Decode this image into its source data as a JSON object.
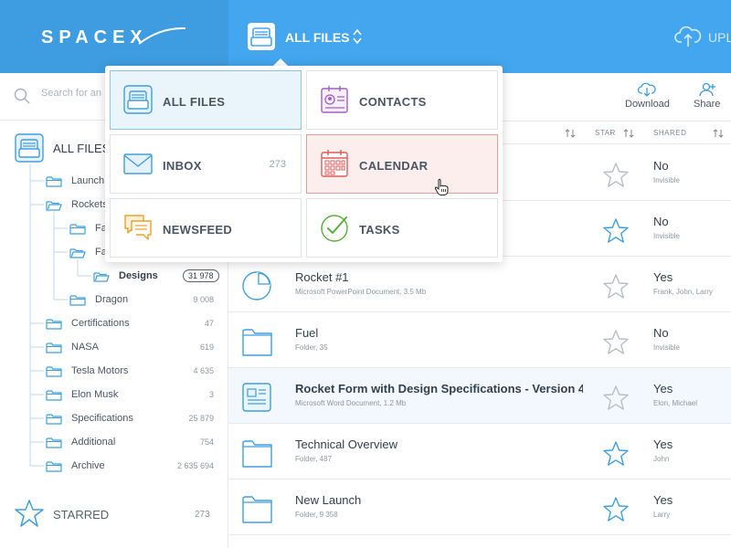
{
  "brand": {
    "logo_text": "SPACEX"
  },
  "topbar": {
    "title": "ALL FILES",
    "upload_label": "UPL"
  },
  "search": {
    "placeholder": "Search for an"
  },
  "sidebar": {
    "all_files_label": "ALL FILES",
    "tree": [
      {
        "label": "Launch",
        "count": ""
      },
      {
        "label": "Rockets",
        "count": ""
      },
      {
        "label": "Fa",
        "count": ""
      },
      {
        "label": "Fa",
        "count": ""
      },
      {
        "label": "Designs",
        "count": "31 978"
      },
      {
        "label": "Dragon",
        "count": "9 008"
      },
      {
        "label": "Certifications",
        "count": "47"
      },
      {
        "label": "NASA",
        "count": "619"
      },
      {
        "label": "Tesla Motors",
        "count": "4 635"
      },
      {
        "label": "Elon Musk",
        "count": "3"
      },
      {
        "label": "Specifications",
        "count": "25 879"
      },
      {
        "label": "Additional",
        "count": "754"
      },
      {
        "label": "Archive",
        "count": "2 635 694"
      }
    ],
    "starred_label": "STARRED",
    "starred_count": "273"
  },
  "actions": {
    "download_label": "Download",
    "share_label": "Share"
  },
  "columns": {
    "star": "STAR",
    "shared": "SHARED"
  },
  "files": [
    {
      "name": "",
      "sub": "",
      "shared": "No",
      "people": "Invisible",
      "icon": "folder-icon",
      "starred": false
    },
    {
      "name": "",
      "sub": "",
      "shared": "No",
      "people": "Invisible",
      "icon": "folder-icon",
      "starred": true
    },
    {
      "name": "Rocket #1",
      "sub": "Microsoft PowerPoint Document,  3.5 Mb",
      "shared": "Yes",
      "people": "Frank, John, Larry",
      "icon": "pie-chart-icon",
      "starred": false
    },
    {
      "name": "Fuel",
      "sub": "Folder,  35",
      "shared": "No",
      "people": "Invisible",
      "icon": "folder-icon",
      "starred": false
    },
    {
      "name": "Rocket Form with Design Specifications - Version 4",
      "sub": "Microsoft Word Document,  1.2 Mb",
      "shared": "Yes",
      "people": "Elon, Michael",
      "icon": "document-icon",
      "starred": false
    },
    {
      "name": "Technical Overview",
      "sub": "Folder,  487",
      "shared": "Yes",
      "people": "John",
      "icon": "folder-icon",
      "starred": true
    },
    {
      "name": "New Launch",
      "sub": "Folder,  9 358",
      "shared": "Yes",
      "people": "Larry",
      "icon": "folder-icon",
      "starred": true
    }
  ],
  "dropdown": {
    "tiles": [
      {
        "label": "ALL FILES",
        "count": "",
        "icon": "files-icon",
        "state": "active"
      },
      {
        "label": "CONTACTS",
        "count": "",
        "icon": "contacts-icon",
        "state": ""
      },
      {
        "label": "INBOX",
        "count": "273",
        "icon": "envelope-icon",
        "state": ""
      },
      {
        "label": "CALENDAR",
        "count": "",
        "icon": "calendar-icon",
        "state": "hover"
      },
      {
        "label": "NEWSFEED",
        "count": "",
        "icon": "chat-bubbles-icon",
        "state": ""
      },
      {
        "label": "TASKS",
        "count": "",
        "icon": "checkmark-icon",
        "state": ""
      }
    ]
  },
  "colors": {
    "brand_blue": "#43a6ee",
    "logo_blue": "#3d9de0",
    "icon_blue": "#3e9fdf",
    "calendar_red": "#e05a5a",
    "contacts_purple": "#a05fc8",
    "newsfeed_orange": "#f0a020",
    "tasks_green": "#5aae3a"
  }
}
